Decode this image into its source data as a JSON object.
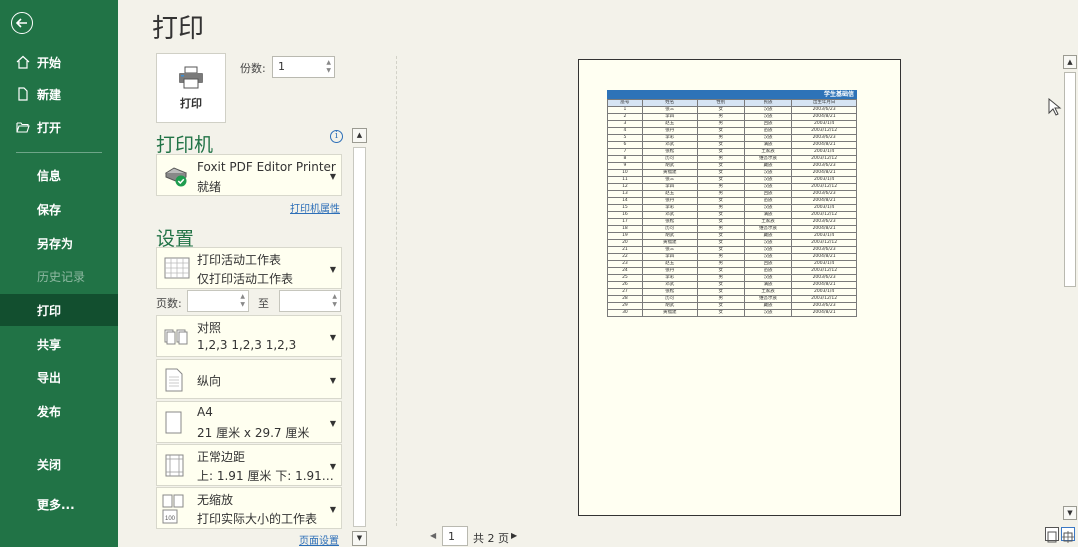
{
  "nav": {
    "items": [
      {
        "label": "开始",
        "icon": "home-icon"
      },
      {
        "label": "新建",
        "icon": "new-file-icon"
      },
      {
        "label": "打开",
        "icon": "open-folder-icon"
      },
      {
        "label": "信息"
      },
      {
        "label": "保存"
      },
      {
        "label": "另存为"
      },
      {
        "label": "历史记录",
        "disabled": true
      },
      {
        "label": "打印",
        "active": true
      },
      {
        "label": "共享"
      },
      {
        "label": "导出"
      },
      {
        "label": "发布"
      },
      {
        "label": "关闭"
      },
      {
        "label": "更多..."
      }
    ]
  },
  "title": "打印",
  "print_button": {
    "label": "打印"
  },
  "copies": {
    "label": "份数:",
    "value": "1"
  },
  "printer": {
    "heading": "打印机",
    "name": "Foxit PDF Editor Printer",
    "status": "就绪",
    "properties_link": "打印机属性"
  },
  "settings": {
    "heading": "设置",
    "scope": {
      "title": "打印活动工作表",
      "subtitle": "仅打印活动工作表"
    },
    "pages_label": "页数:",
    "to_label": "至",
    "collate": {
      "title": "对照",
      "subtitle": "1,2,3    1,2,3    1,2,3"
    },
    "orientation": {
      "title": "纵向"
    },
    "paper": {
      "title": "A4",
      "subtitle": "21 厘米 x 29.7 厘米"
    },
    "margins": {
      "title": "正常边距",
      "subtitle": "上: 1.91 厘米 下: 1.91…"
    },
    "scaling": {
      "title": "无缩放",
      "subtitle": "打印实际大小的工作表"
    },
    "page_setup_link": "页面设置"
  },
  "pager": {
    "current": "1",
    "total_text": "共 2 页"
  },
  "sheet": {
    "title": "学生基础信",
    "headers": [
      "座号",
      "姓名",
      "性别",
      "民族",
      "出生年月日"
    ],
    "rows": [
      [
        "1",
        "张三",
        "女",
        "汉族",
        "2003/6/23"
      ],
      [
        "2",
        "李四",
        "男",
        "汉族",
        "2004/8/21"
      ],
      [
        "3",
        "赵五",
        "男",
        "回族",
        "2003/1/4"
      ],
      [
        "4",
        "张丹",
        "女",
        "苗族",
        "2003/12/12"
      ],
      [
        "5",
        "李彩",
        "男",
        "汉族",
        "2003/6/23"
      ],
      [
        "6",
        "邓武",
        "女",
        "满族",
        "2004/8/21"
      ],
      [
        "7",
        "张松",
        "女",
        "土家族",
        "2003/1/4"
      ],
      [
        "8",
        "历可",
        "男",
        "维吾尔族",
        "2003/12/12"
      ],
      [
        "9",
        "胡武",
        "女",
        "藏族",
        "2003/6/23"
      ],
      [
        "10",
        "黄福建",
        "女",
        "汉族",
        "2004/8/21"
      ],
      [
        "11",
        "张三",
        "女",
        "汉族",
        "2003/1/4"
      ],
      [
        "12",
        "李四",
        "男",
        "汉族",
        "2003/12/12"
      ],
      [
        "13",
        "赵五",
        "男",
        "回族",
        "2003/6/23"
      ],
      [
        "14",
        "张丹",
        "女",
        "苗族",
        "2004/8/21"
      ],
      [
        "15",
        "李彩",
        "男",
        "汉族",
        "2003/1/4"
      ],
      [
        "16",
        "邓武",
        "女",
        "满族",
        "2003/12/12"
      ],
      [
        "17",
        "张松",
        "女",
        "土家族",
        "2003/6/23"
      ],
      [
        "18",
        "历可",
        "男",
        "维吾尔族",
        "2004/8/21"
      ],
      [
        "19",
        "胡武",
        "女",
        "藏族",
        "2003/1/4"
      ],
      [
        "20",
        "黄福建",
        "女",
        "汉族",
        "2003/12/12"
      ],
      [
        "21",
        "张三",
        "女",
        "汉族",
        "2003/6/23"
      ],
      [
        "22",
        "李四",
        "男",
        "汉族",
        "2004/8/21"
      ],
      [
        "23",
        "赵五",
        "男",
        "回族",
        "2003/1/4"
      ],
      [
        "24",
        "张丹",
        "女",
        "苗族",
        "2003/12/12"
      ],
      [
        "25",
        "李彩",
        "男",
        "汉族",
        "2003/6/23"
      ],
      [
        "26",
        "邓武",
        "女",
        "满族",
        "2004/8/21"
      ],
      [
        "27",
        "张松",
        "女",
        "土家族",
        "2003/1/4"
      ],
      [
        "28",
        "历可",
        "男",
        "维吾尔族",
        "2003/12/12"
      ],
      [
        "29",
        "胡武",
        "女",
        "藏族",
        "2003/6/23"
      ],
      [
        "30",
        "黄福建",
        "女",
        "汉族",
        "2004/8/21"
      ]
    ]
  },
  "colors": {
    "nav_bg": "#217346",
    "nav_active": "#124f2f",
    "accent": "#217346",
    "link": "#2d6fb8",
    "table_header": "#2e73b8"
  }
}
